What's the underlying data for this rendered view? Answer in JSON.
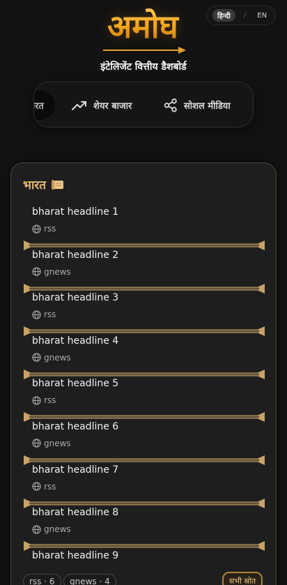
{
  "language": {
    "active": "हिन्दी",
    "separator": "/",
    "other": "EN"
  },
  "brand": {
    "logo_text": "अमोघ",
    "tagline": "इंटेलिजेंट वित्तीय डैशबोर्ड"
  },
  "tabs": [
    {
      "label": "भारत",
      "visible_text": "ारत",
      "icon": "flag-icon",
      "state": "active"
    },
    {
      "label": "शेयर बाजार",
      "icon": "trending-up-icon"
    },
    {
      "label": "सोशल मीडिया",
      "icon": "share-icon"
    }
  ],
  "card": {
    "title": "भारत",
    "title_icon": "scroll-icon",
    "items": [
      {
        "title": "bharat headline 1",
        "source": "rss"
      },
      {
        "title": "bharat headline 2",
        "source": "gnews"
      },
      {
        "title": "bharat headline 3",
        "source": "rss"
      },
      {
        "title": "bharat headline 4",
        "source": "gnews"
      },
      {
        "title": "bharat headline 5",
        "source": "rss"
      },
      {
        "title": "bharat headline 6",
        "source": "gnews"
      },
      {
        "title": "bharat headline 7",
        "source": "rss"
      },
      {
        "title": "bharat headline 8",
        "source": "gnews"
      },
      {
        "title": "bharat headline 9",
        "source": ""
      }
    ],
    "source_counts": [
      "rss · 6",
      "gnews · 4"
    ],
    "all_sources_label": "सभी स्रोत"
  },
  "colors": {
    "accent_gold": "#e6b870",
    "background": "#121212",
    "card": "#1e1e1e"
  }
}
